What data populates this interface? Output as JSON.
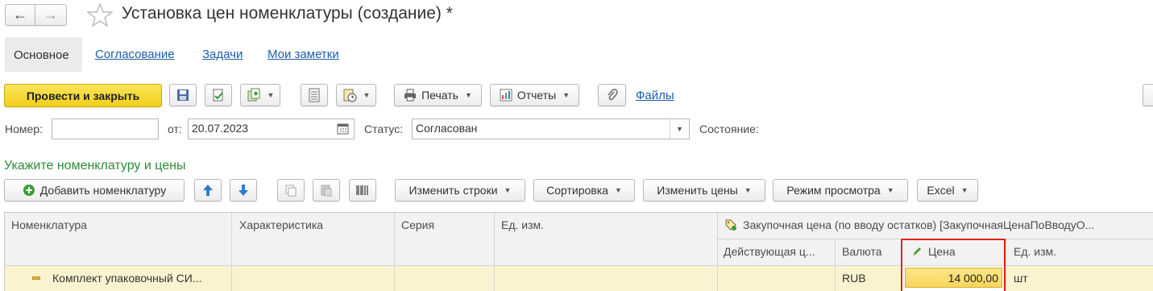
{
  "window": {
    "title": "Установка цен номенклатуры (создание) *"
  },
  "tabs": [
    {
      "label": "Основное"
    },
    {
      "label": "Согласование"
    },
    {
      "label": "Задачи"
    },
    {
      "label": "Мои заметки"
    }
  ],
  "toolbar": {
    "post_close": "Провести и закрыть",
    "print": "Печать",
    "reports": "Отчеты",
    "files": "Файлы"
  },
  "form": {
    "number_label": "Номер:",
    "number_value": "",
    "date_label": "от:",
    "date_value": "20.07.2023",
    "status_label": "Статус:",
    "status_value": "Согласован",
    "state_label": "Состояние:"
  },
  "section": {
    "title": "Укажите номенклатуру и цены",
    "add_item": "Добавить номенклатуру",
    "change_rows": "Изменить строки",
    "sort": "Сортировка",
    "change_prices": "Изменить цены",
    "view_mode": "Режим просмотра",
    "excel": "Excel"
  },
  "table": {
    "headers": {
      "item": "Номенклатура",
      "characteristic": "Характеристика",
      "series": "Серия",
      "unit": "Ед. изм.",
      "price_group": "Закупочная цена (по вводу остатков) [ЗакупочнаяЦенаПоВводуО...",
      "current": "Действующая ц...",
      "currency": "Валюта",
      "price": "Цена",
      "price_unit": "Ед. изм."
    },
    "rows": [
      {
        "item": "Комплект упаковочный СИ...",
        "characteristic": "",
        "series": "",
        "unit": "",
        "current": "",
        "currency": "RUB",
        "price": "14 000,00",
        "price_unit": "шт"
      }
    ]
  },
  "colors": {
    "accent_yellow": "#f5d52a",
    "row_highlight": "#fbf3cf",
    "link_blue": "#1d5ea8",
    "section_green": "#2e8b3b",
    "selection_red": "#e0241b"
  }
}
